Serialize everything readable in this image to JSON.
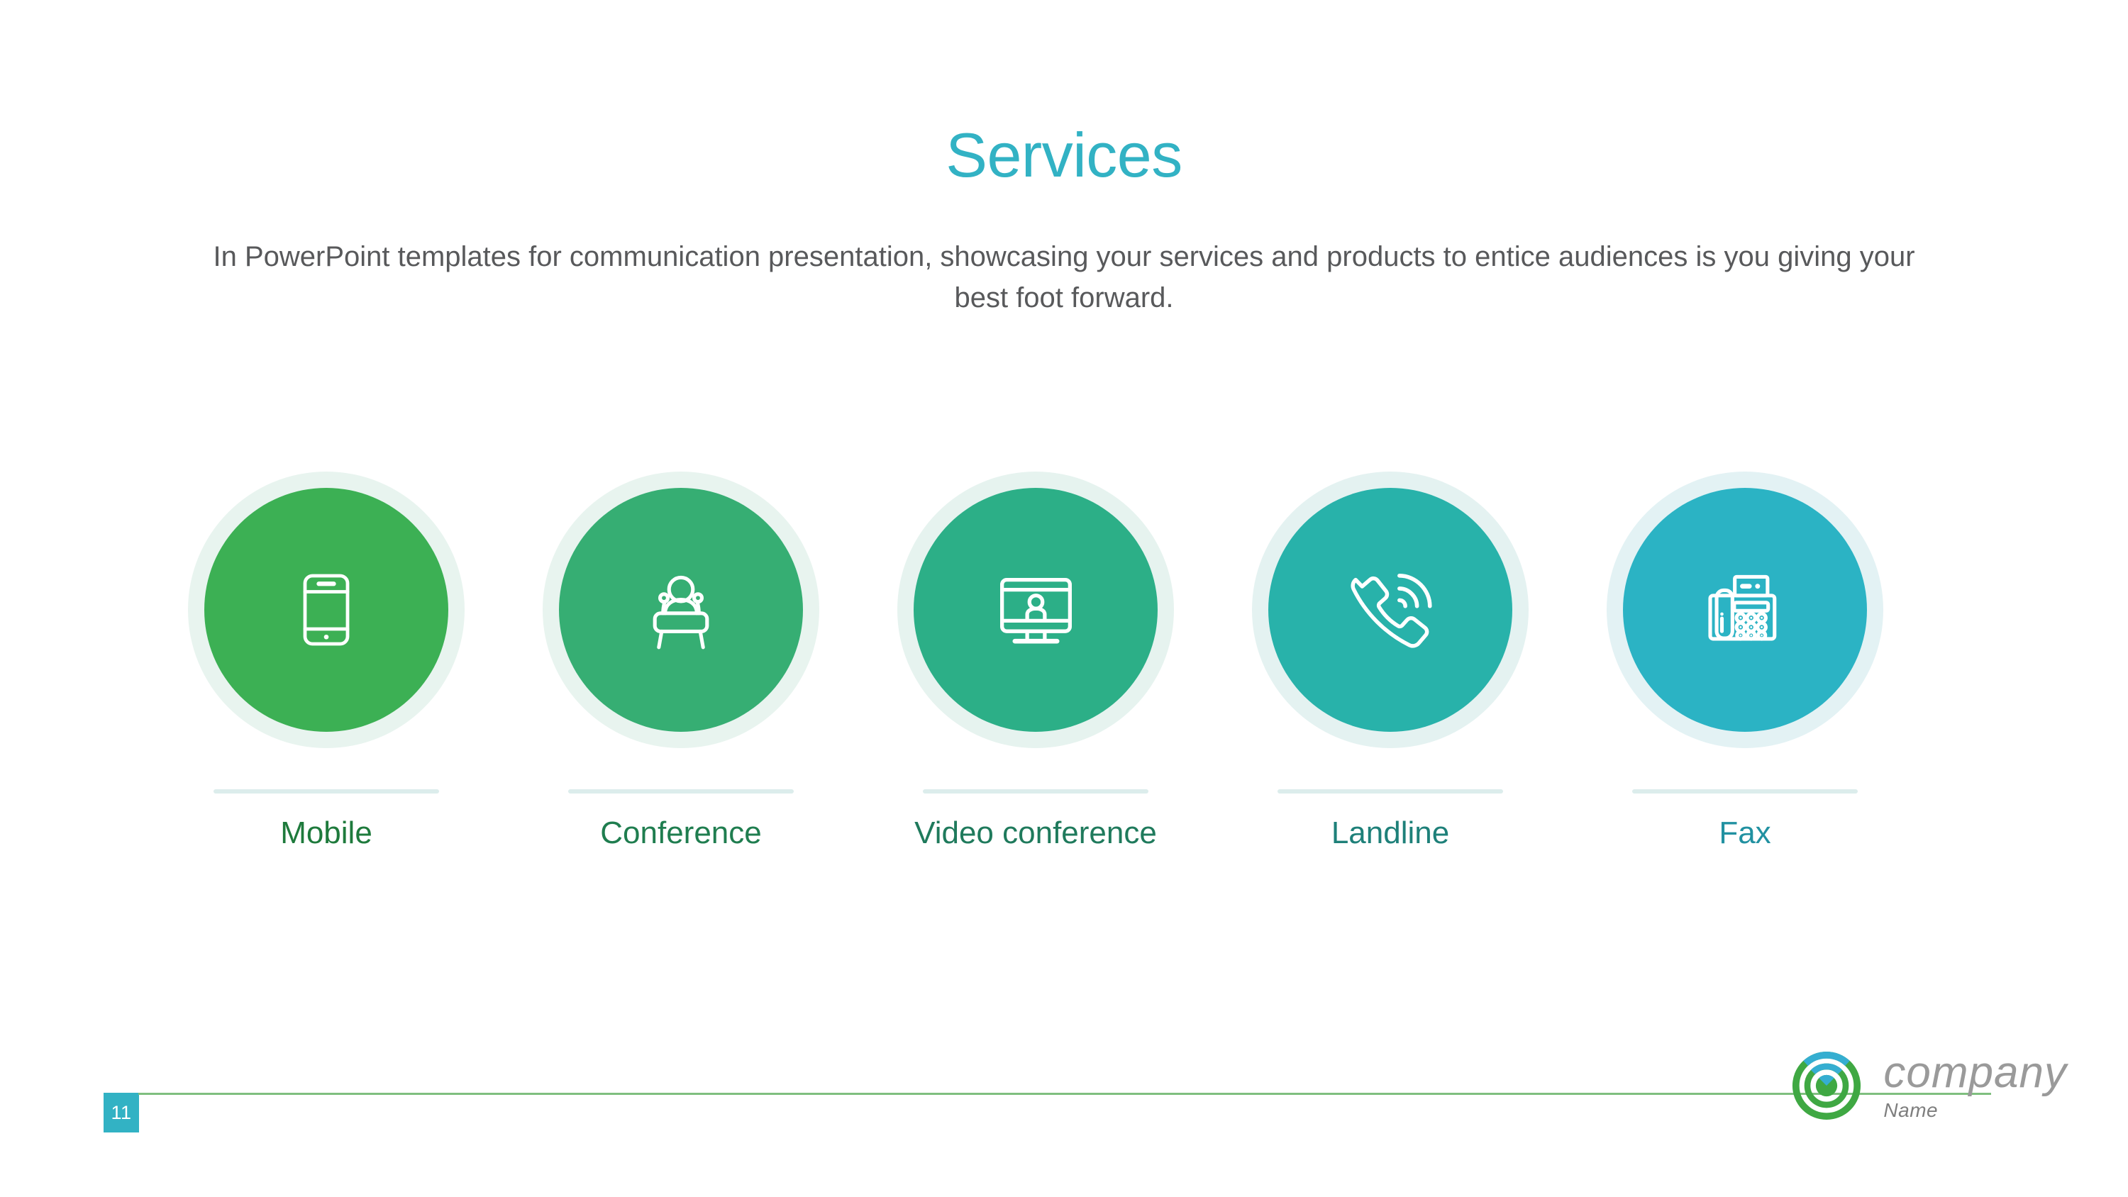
{
  "slide": {
    "title": "Services",
    "subtitle": "In PowerPoint templates for communication presentation, showcasing your services and products to entice audiences is you giving your best foot forward.",
    "title_color": "#32B2C4",
    "background_color": "#FFFFFF"
  },
  "services": [
    {
      "label": "Mobile",
      "icon": "smartphone-icon",
      "circle_color": "#3CB054",
      "ring_color": "#E8F4EF",
      "label_color": "#1E7A3C"
    },
    {
      "label": "Conference",
      "icon": "podium-speaker-icon",
      "circle_color": "#36AE73",
      "ring_color": "#E8F4EF",
      "label_color": "#1F7D4F"
    },
    {
      "label": "Video conference",
      "icon": "monitor-person-icon",
      "circle_color": "#2CAF87",
      "ring_color": "#E6F3EF",
      "label_color": "#1F7A5C"
    },
    {
      "label": "Landline",
      "icon": "phone-handset-waves-icon",
      "circle_color": "#28B2AA",
      "ring_color": "#E4F2F1",
      "label_color": "#1E8079"
    },
    {
      "label": "Fax",
      "icon": "fax-machine-icon",
      "circle_color": "#2BB3C4",
      "ring_color": "#E3F2F4",
      "label_color": "#2191A1"
    }
  ],
  "footer": {
    "page_number": "11",
    "page_badge_color": "#32B2C4",
    "rule_color": "#7FBF7F",
    "brand_name": "company",
    "brand_sub": "Name",
    "logo_icon": "concentric-rings-logo-icon",
    "logo_green": "#3FA843",
    "logo_blue": "#35AED1"
  }
}
